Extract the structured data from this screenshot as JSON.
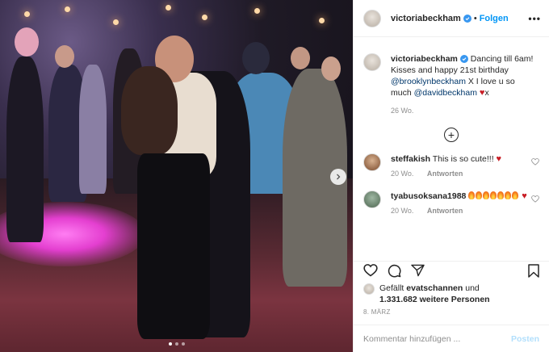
{
  "header": {
    "username": "victoriabeckham",
    "separator": "•",
    "follow_label": "Folgen",
    "more_label": "•••"
  },
  "caption": {
    "username": "victoriabeckham",
    "text_1": "Dancing till 6am! Kisses and happy 21st birthday",
    "mention_1": "@brooklynbeckham",
    "text_2": "X I love u so much",
    "mention_2": "@davidbeckham",
    "text_3": "x",
    "time": "26 Wo."
  },
  "comments": [
    {
      "username": "steffakish",
      "text": "This is so cute!!!",
      "time": "20 Wo.",
      "reply_label": "Antworten"
    },
    {
      "username": "tyabusoksana1988",
      "text": "",
      "time": "20 Wo.",
      "reply_label": "Antworten"
    }
  ],
  "likes": {
    "prefix": "Gefällt",
    "liker": "evatschannen",
    "conjunction": "und",
    "count_text": "1.331.682 weitere Personen"
  },
  "date": "8. MÄRZ",
  "add_comment": {
    "placeholder": "Kommentar hinzufügen ...",
    "post_label": "Posten"
  },
  "colors": {
    "accent": "#0095f6",
    "verified": "#3897f0",
    "post_disabled": "#b2dffc",
    "heart_emoji": "#c81d25"
  },
  "carousel": {
    "current": 1,
    "total": 3
  }
}
